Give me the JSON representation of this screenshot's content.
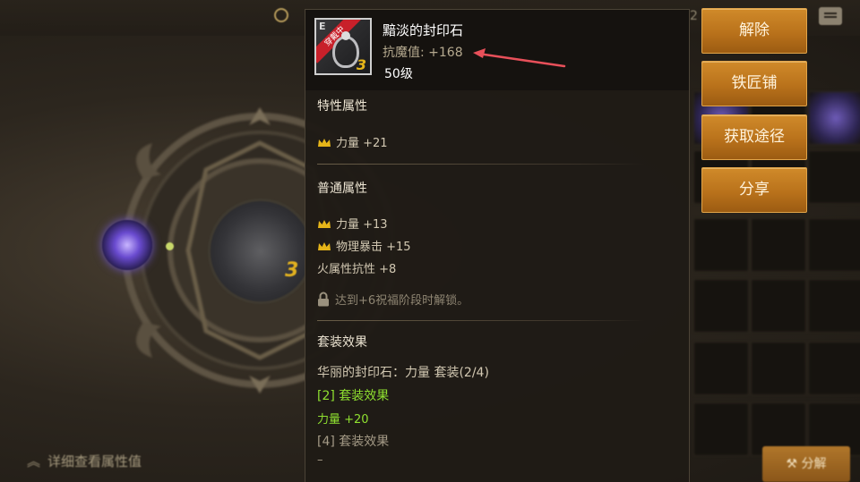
{
  "background": {
    "top_number": "2",
    "detail_link_label": "详细查看属性值",
    "decompose_button_label": "分解",
    "center_stone_level": "3"
  },
  "tooltip": {
    "item": {
      "grade_letter": "E",
      "equipped_ribbon": "穿戴中",
      "icon_level": "3",
      "name": "黯淡的封印石",
      "stat_label": "抗魔值:",
      "stat_value": "+168",
      "level_requirement": "50级"
    },
    "special_attributes": {
      "title": "特性属性",
      "items": [
        {
          "text": "力量 +21",
          "icon": "crown-icon"
        }
      ]
    },
    "normal_attributes": {
      "title": "普通属性",
      "items": [
        {
          "text": "力量 +13",
          "icon": "crown-icon"
        },
        {
          "text": "物理暴击 +15",
          "icon": "crown-icon"
        },
        {
          "text": "火属性抗性 +8",
          "icon": ""
        }
      ],
      "locked_text": "达到+6祝福阶段时解锁。"
    },
    "set_effect": {
      "title": "套装效果",
      "set_name_line": "华丽的封印石：力量  套装(2/4)",
      "tier2_label": "[2] 套装效果",
      "tier2_bonus": "力量 +20",
      "tier4_label": "[4] 套装效果",
      "tier4_bonus": "–"
    }
  },
  "actions": {
    "release": "解除",
    "blacksmith": "铁匠铺",
    "obtain_route": "获取途径",
    "share": "分享"
  },
  "colors": {
    "panel_bg": "#1f1b16",
    "header_bg": "#15120f",
    "button_orange": "#c07a20",
    "set_green": "#8fe030",
    "crown_gold": "#e6b519",
    "arrow_red": "#e8505a"
  }
}
